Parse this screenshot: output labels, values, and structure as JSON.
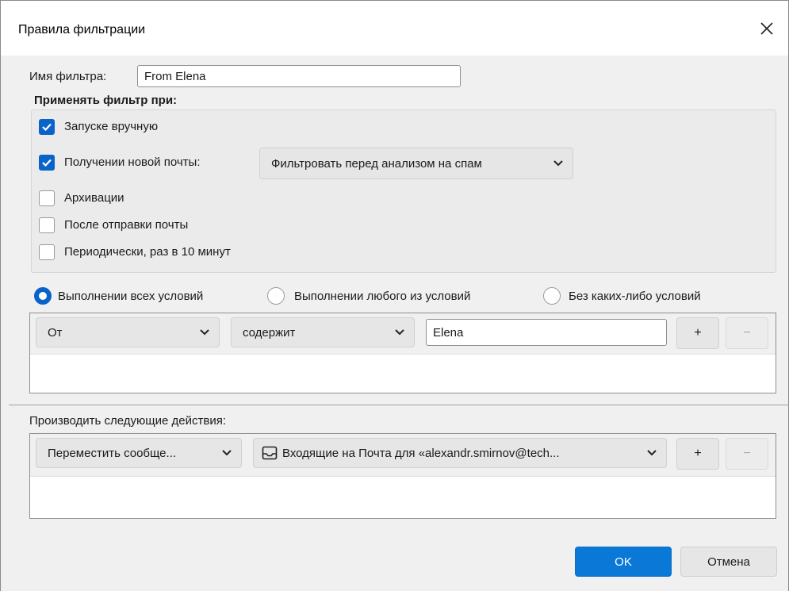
{
  "window": {
    "title": "Правила фильтрации"
  },
  "filter_name": {
    "label": "Имя фильтра:",
    "value": "From Elena"
  },
  "apply_group": {
    "heading": "Применять фильтр при:",
    "options": [
      {
        "label": "Запуске вручную",
        "checked": true
      },
      {
        "label": "Получении новой почты:",
        "checked": true
      },
      {
        "label": "Архивации",
        "checked": false
      },
      {
        "label": "После отправки почты",
        "checked": false
      },
      {
        "label": "Периодически, раз в 10 минут",
        "checked": false
      }
    ],
    "spam_dropdown": "Фильтровать перед анализом на спам"
  },
  "match_mode": {
    "options": [
      {
        "label": "Выполнении всех условий",
        "selected": true
      },
      {
        "label": "Выполнении любого из условий",
        "selected": false
      },
      {
        "label": "Без каких-либо условий",
        "selected": false
      }
    ]
  },
  "conditions": [
    {
      "field": "От",
      "operator": "содержит",
      "value": "Elena"
    }
  ],
  "actions": {
    "heading": "Производить следующие действия:",
    "items": [
      {
        "action": "Переместить сообще...",
        "target": "Входящие на Почта для «alexandr.smirnov@tech..."
      }
    ]
  },
  "buttons": {
    "add": "+",
    "remove": "−",
    "ok": "OK",
    "cancel": "Отмена"
  },
  "colors": {
    "accent": "#0a63c9",
    "ok_button": "#0a78d7"
  }
}
